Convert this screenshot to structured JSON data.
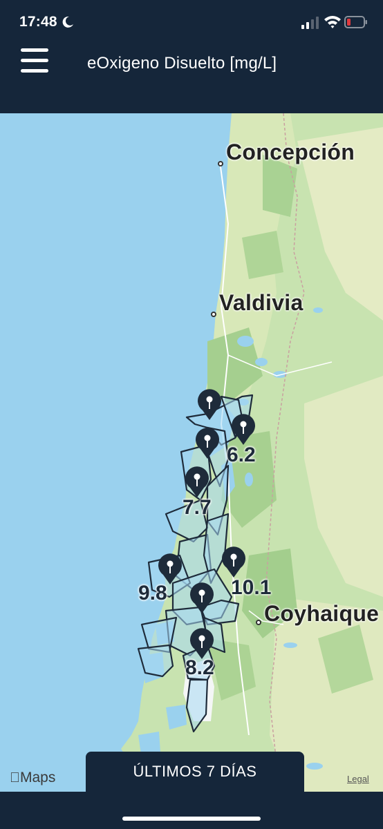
{
  "status_bar": {
    "time": "17:48"
  },
  "header": {
    "title": "eOxigeno Disuelto [mg/L]"
  },
  "map": {
    "cities": [
      "Concepción",
      "Valdivia",
      "Coyhaique"
    ],
    "stations": [
      {
        "value": ""
      },
      {
        "value": "6.2"
      },
      {
        "value": ""
      },
      {
        "value": "7.7"
      },
      {
        "value": "9.8"
      },
      {
        "value": "10.1"
      },
      {
        "value": ""
      },
      {
        "value": "8.2"
      }
    ],
    "attribution": "Maps",
    "legal": "Legal"
  },
  "footer": {
    "period_label": "ÚLTIMOS 7 DÍAS"
  },
  "colors": {
    "header_bg": "#15263a",
    "water": "#9ad1ee",
    "land": "#c8e3b0",
    "pin": "#1e2b3a"
  }
}
